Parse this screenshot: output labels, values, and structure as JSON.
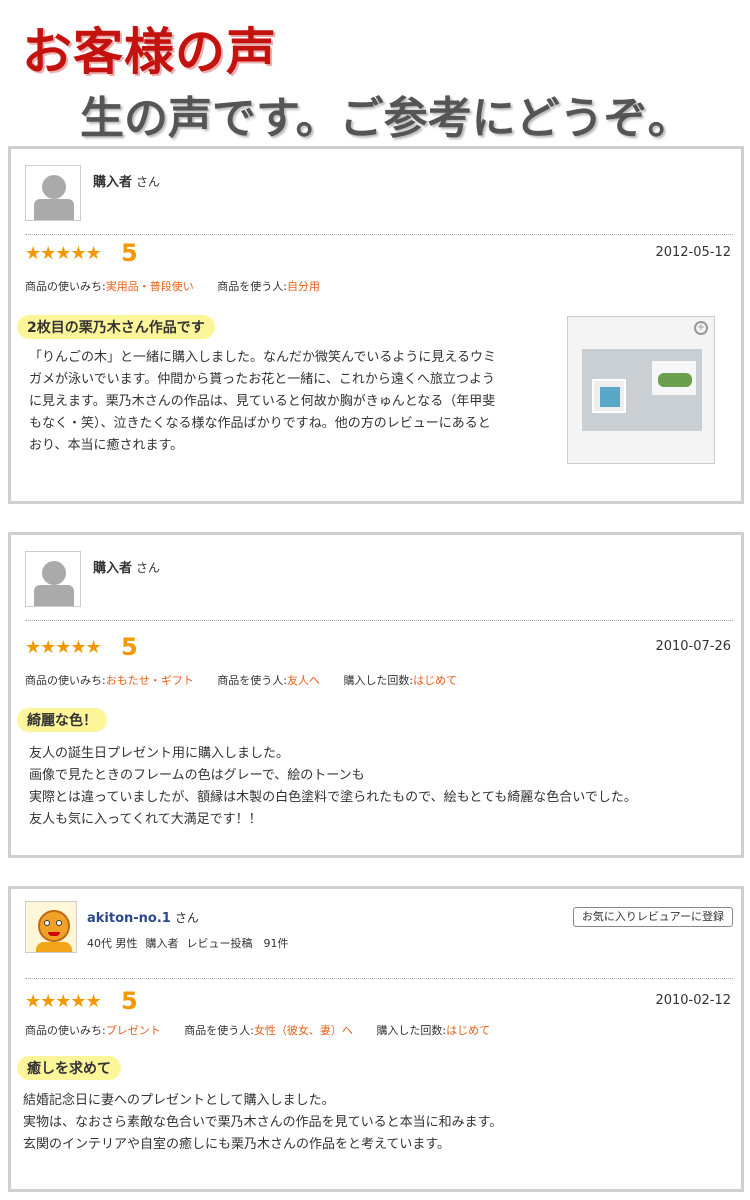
{
  "header": {
    "title": "お客様の声",
    "subtitle": "生の声です。ご参考にどうぞ。"
  },
  "reviews": [
    {
      "reviewer": "購入者",
      "honorific": "さん",
      "stars": "★★★★★",
      "score": "5",
      "date": "2012-05-12",
      "meta": [
        {
          "label": "商品の使いみち:",
          "value": "実用品・普段使い"
        },
        {
          "label": "商品を使う人:",
          "value": "自分用"
        }
      ],
      "headline": "2枚目の栗乃木さん作品です",
      "body": [
        "「りんごの木」と一緒に購入しました。なんだか微笑んでいるように見えるウミ",
        "ガメが泳いでいます。仲間から貰ったお花と一緒に、これから遠くへ旅立つよう",
        "に見えます。栗乃木さんの作品は、見ていると何故か胸がきゅんとなる（年甲斐",
        "もなく・笑）、泣きたくなる様な作品ばかりですね。他の方のレビューにあると",
        "おり、本当に癒されます。"
      ]
    },
    {
      "reviewer": "購入者",
      "honorific": "さん",
      "stars": "★★★★★",
      "score": "5",
      "date": "2010-07-26",
      "meta": [
        {
          "label": "商品の使いみち:",
          "value": "おもたせ・ギフト"
        },
        {
          "label": "商品を使う人:",
          "value": "友人へ"
        },
        {
          "label": "購入した回数:",
          "value": "はじめて"
        }
      ],
      "headline": "綺麗な色！",
      "body": [
        "友人の誕生日プレゼント用に購入しました。",
        "画像で見たときのフレームの色はグレーで、絵のトーンも",
        "実際とは違っていましたが、額縁は木製の白色塗料で塗られたもので、絵もとても綺麗な色合いでした。",
        "友人も気に入ってくれて大満足です！！"
      ]
    },
    {
      "reviewer": "akiton-no.1",
      "honorific": "さん",
      "profile": [
        "40代 男性",
        "購入者",
        "レビュー投稿　91件"
      ],
      "fav_button": "お気に入りレビュアーに登録",
      "stars": "★★★★★",
      "score": "5",
      "date": "2010-02-12",
      "meta": [
        {
          "label": "商品の使いみち:",
          "value": "プレゼント"
        },
        {
          "label": "商品を使う人:",
          "value": "女性（彼女、妻）へ"
        },
        {
          "label": "購入した回数:",
          "value": "はじめて"
        }
      ],
      "headline": "癒しを求めて",
      "body": [
        "結婚記念日に妻へのプレゼントとして購入しました。",
        "実物は、なおさら素敵な色合いで栗乃木さんの作品を見ていると本当に和みます。",
        "玄関のインテリアや自室の癒しにも栗乃木さんの作品をと考えています。"
      ]
    }
  ],
  "colors": {
    "title": "#c4120f",
    "accent": "#f39800",
    "meta_value": "#e8601c",
    "headline_bg": "#fdf59a",
    "border": "#cfcfcf"
  }
}
